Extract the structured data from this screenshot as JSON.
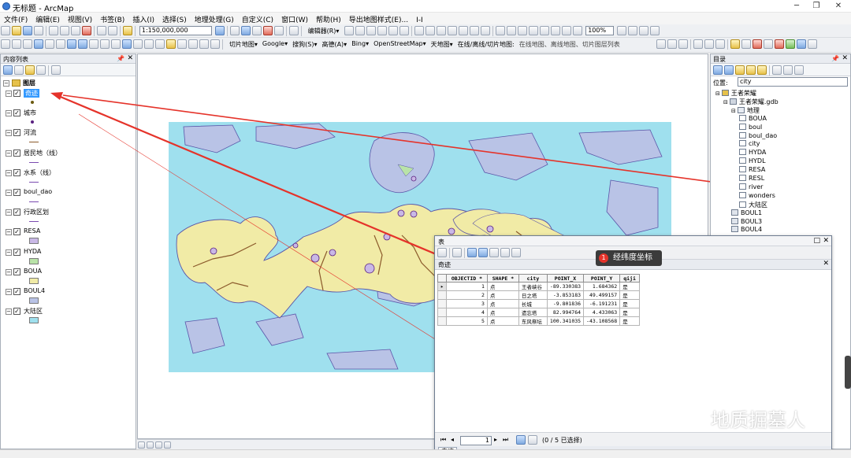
{
  "window": {
    "title": "无标题 - ArcMap",
    "controls": [
      "─",
      "❐",
      "✕"
    ]
  },
  "menu": [
    "文件(F)",
    "编辑(E)",
    "视图(V)",
    "书签(B)",
    "插入(I)",
    "选择(S)",
    "地理处理(G)",
    "自定义(C)",
    "窗口(W)",
    "帮助(H)",
    "导出地图样式(E)...",
    "I-I"
  ],
  "toolbar1": {
    "scale": "1:150,000,000",
    "editor_label": "编辑器(R)▾",
    "zoom_pct": "100%"
  },
  "toolbar2": {
    "items": [
      "切片地图▾",
      "Google▾",
      "搜狗(S)▾",
      "高德(A)▾",
      "Bing▾",
      "OpenStreetMap▾",
      "天地图▾",
      "在线/离线/切片地图:",
      "在线地图、离线地图、切片图层列表"
    ]
  },
  "toc": {
    "title": "内容列表",
    "root": "图层",
    "layers": [
      {
        "name": "奇迹",
        "selected": true,
        "symbol": "point",
        "color": "#6b5a10"
      },
      {
        "name": "城市",
        "selected": false,
        "symbol": "point",
        "color": "#5a2080"
      },
      {
        "name": "河流",
        "selected": false,
        "symbol": "line",
        "color": "#8b5a2b"
      },
      {
        "name": "居民地（线）",
        "selected": false,
        "symbol": "line",
        "color": "#7a4ab0"
      },
      {
        "name": "水系（线）",
        "selected": false,
        "symbol": "line",
        "color": "#7a4ab0"
      },
      {
        "name": "boul_dao",
        "selected": false,
        "symbol": "line",
        "color": "#7a4ab0"
      },
      {
        "name": "行政区划",
        "selected": false,
        "symbol": "line",
        "color": "#7a4ab0"
      },
      {
        "name": "RESA",
        "selected": false,
        "symbol": "fill",
        "color": "#c9b8e6"
      },
      {
        "name": "HYDA",
        "selected": false,
        "symbol": "fill",
        "color": "#b9e3a8"
      },
      {
        "name": "BOUA",
        "selected": false,
        "symbol": "fill",
        "color": "#f1eba6"
      },
      {
        "name": "BOUL4",
        "selected": false,
        "symbol": "fill",
        "color": "#b9c3e6"
      },
      {
        "name": "大陆区",
        "selected": false,
        "symbol": "fill",
        "color": "#9fe0ee"
      }
    ]
  },
  "catalog": {
    "title": "目录",
    "location_label": "位置:",
    "location_value": "city",
    "tree": [
      {
        "name": "王者荣耀",
        "level": 0,
        "icon": "folder"
      },
      {
        "name": "王者荣耀.gdb",
        "level": 1,
        "icon": "gdb"
      },
      {
        "name": "地理",
        "level": 2,
        "icon": "dataset"
      },
      {
        "name": "BOUA",
        "level": 3,
        "icon": "fc"
      },
      {
        "name": "boul",
        "level": 3,
        "icon": "fc"
      },
      {
        "name": "boul_dao",
        "level": 3,
        "icon": "fc"
      },
      {
        "name": "city",
        "level": 3,
        "icon": "fc"
      },
      {
        "name": "HYDA",
        "level": 3,
        "icon": "fc"
      },
      {
        "name": "HYDL",
        "level": 3,
        "icon": "fc"
      },
      {
        "name": "RESA",
        "level": 3,
        "icon": "fc"
      },
      {
        "name": "RESL",
        "level": 3,
        "icon": "fc"
      },
      {
        "name": "river",
        "level": 3,
        "icon": "fc"
      },
      {
        "name": "wonders",
        "level": 3,
        "icon": "fc"
      },
      {
        "name": "大陆区",
        "level": 3,
        "icon": "fc"
      },
      {
        "name": "BOUL1",
        "level": 2,
        "icon": "table"
      },
      {
        "name": "BOUL3",
        "level": 2,
        "icon": "table"
      },
      {
        "name": "BOUL4",
        "level": 2,
        "icon": "table"
      }
    ]
  },
  "table": {
    "window_title": "表",
    "tab_name": "奇迹",
    "columns": [
      "OBJECTID *",
      "SHAPE *",
      "city",
      "POINT_X",
      "POINT_Y",
      "qiji"
    ],
    "rows": [
      [
        "1",
        "点",
        "王者峡谷",
        "-89.330383",
        "1.684362",
        "是"
      ],
      [
        "2",
        "点",
        "日之塔",
        "-3.853183",
        "49.499157",
        "是"
      ],
      [
        "3",
        "点",
        "长城",
        "-9.801836",
        "-6.191231",
        "是"
      ],
      [
        "4",
        "点",
        "遗忘塔",
        "82.994764",
        "4.433063",
        "是"
      ],
      [
        "5",
        "点",
        "东风祭坛",
        "100.341035",
        "-43.108568",
        "是"
      ]
    ],
    "nav_record": "1",
    "selection_status": "(0 / 5 已选择)",
    "footer_tab": "奇迹"
  },
  "callout": {
    "badge": "1",
    "text": "经纬度坐标"
  },
  "watermark": "地质掘墓人",
  "colors": {
    "sea": "#9fe0ee",
    "land": "#f1eba6",
    "island": "#b9c3e6",
    "arrow": "#e5332a"
  }
}
